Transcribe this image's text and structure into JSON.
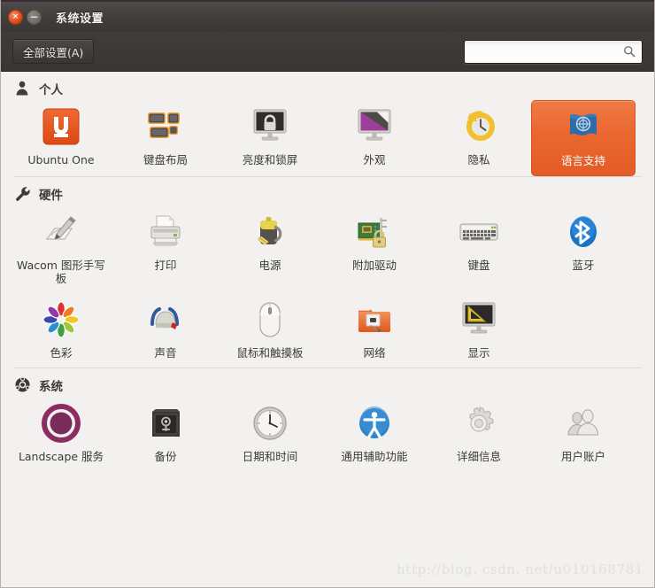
{
  "window": {
    "title": "系统设置",
    "close_label": "×",
    "minimize_label": "−"
  },
  "toolbar": {
    "all_settings_label": "全部设置(A)",
    "search_value": "",
    "search_placeholder": "",
    "search_icon": "search-icon"
  },
  "watermark": "http://blog. csdn. net/u010168781",
  "colors": {
    "selection_accent": "#e85f28",
    "titlebar": "#413d3a",
    "content_bg": "#f2f1ef",
    "text": "#3b3a38"
  },
  "sections": [
    {
      "id": "personal",
      "title": "个人",
      "icon": "person-icon",
      "items": [
        {
          "label": "Ubuntu One",
          "icon": "ubuntu-one-icon",
          "selected": false
        },
        {
          "label": "键盘布局",
          "icon": "keyboard-layout-icon",
          "selected": false
        },
        {
          "label": "亮度和锁屏",
          "icon": "brightness-lock-icon",
          "selected": false
        },
        {
          "label": "外观",
          "icon": "appearance-icon",
          "selected": false
        },
        {
          "label": "隐私",
          "icon": "privacy-icon",
          "selected": false
        },
        {
          "label": "语言支持",
          "icon": "language-support-icon",
          "selected": true
        }
      ]
    },
    {
      "id": "hardware",
      "title": "硬件",
      "icon": "wrench-icon",
      "items": [
        {
          "label": "Wacom 图形手写板",
          "icon": "wacom-tablet-icon",
          "selected": false
        },
        {
          "label": "打印",
          "icon": "printer-icon",
          "selected": false
        },
        {
          "label": "电源",
          "icon": "power-icon",
          "selected": false
        },
        {
          "label": "附加驱动",
          "icon": "additional-drivers-icon",
          "selected": false
        },
        {
          "label": "键盘",
          "icon": "keyboard-icon",
          "selected": false
        },
        {
          "label": "蓝牙",
          "icon": "bluetooth-icon",
          "selected": false
        },
        {
          "label": "色彩",
          "icon": "color-icon",
          "selected": false
        },
        {
          "label": "声音",
          "icon": "sound-icon",
          "selected": false
        },
        {
          "label": "鼠标和触摸板",
          "icon": "mouse-touchpad-icon",
          "selected": false
        },
        {
          "label": "网络",
          "icon": "network-icon",
          "selected": false
        },
        {
          "label": "显示",
          "icon": "display-icon",
          "selected": false
        }
      ]
    },
    {
      "id": "system",
      "title": "系统",
      "icon": "ubuntu-logo-icon",
      "items": [
        {
          "label": "Landscape 服务",
          "icon": "landscape-icon",
          "selected": false
        },
        {
          "label": "备份",
          "icon": "backup-icon",
          "selected": false
        },
        {
          "label": "日期和时间",
          "icon": "datetime-icon",
          "selected": false
        },
        {
          "label": "通用辅助功能",
          "icon": "accessibility-icon",
          "selected": false
        },
        {
          "label": "详细信息",
          "icon": "details-icon",
          "selected": false
        },
        {
          "label": "用户账户",
          "icon": "user-accounts-icon",
          "selected": false
        }
      ]
    }
  ]
}
